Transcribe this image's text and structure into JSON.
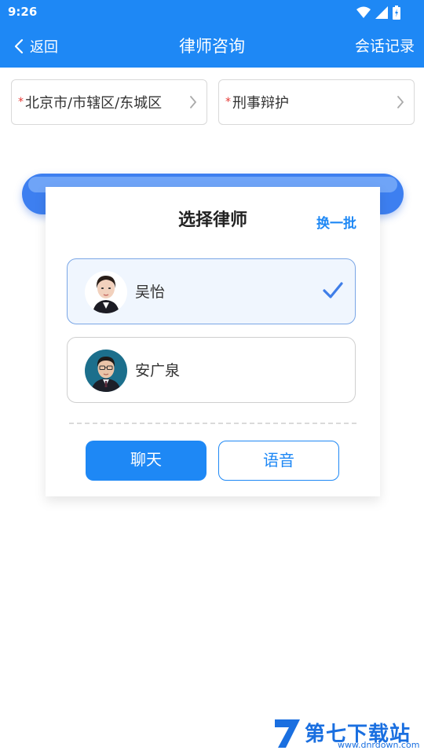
{
  "status_bar": {
    "time": "9:26"
  },
  "app_bar": {
    "back_label": "返回",
    "title": "律师咨询",
    "history_label": "会话记录"
  },
  "selectors": {
    "required_mark": "*",
    "region": "北京市/市辖区/东城区",
    "category": "刑事辩护"
  },
  "card": {
    "title": "选择律师",
    "refresh_label": "换一批",
    "lawyers": [
      {
        "name": "吴怡",
        "selected": true
      },
      {
        "name": "安广泉",
        "selected": false
      }
    ],
    "chat_label": "聊天",
    "voice_label": "语音"
  },
  "watermark": {
    "brand": "第七下载站",
    "url": "www.dnrdown.com"
  },
  "colors": {
    "primary": "#1e88f5",
    "required": "#e53935"
  }
}
